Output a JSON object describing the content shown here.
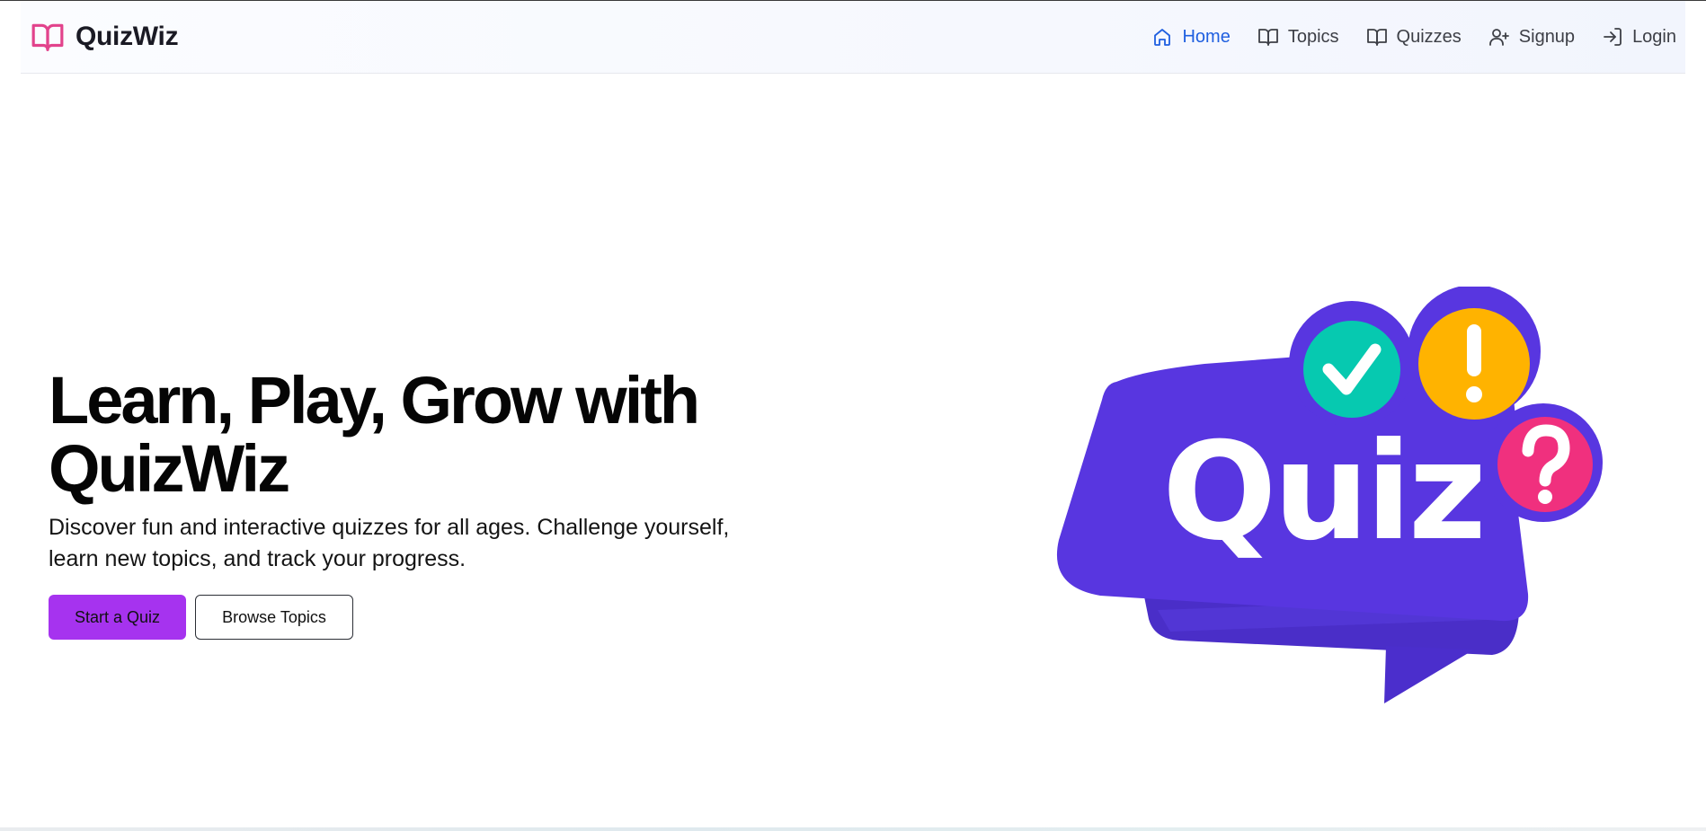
{
  "brand": {
    "name": "QuizWiz",
    "icon": "open-book-icon",
    "icon_color": "#e2438c"
  },
  "nav": {
    "items": [
      {
        "label": "Home",
        "icon": "home-icon",
        "active": true
      },
      {
        "label": "Topics",
        "icon": "open-book-icon",
        "active": false
      },
      {
        "label": "Quizzes",
        "icon": "open-book-icon",
        "active": false
      },
      {
        "label": "Signup",
        "icon": "user-plus-icon",
        "active": false
      },
      {
        "label": "Login",
        "icon": "login-arrow-icon",
        "active": false
      }
    ],
    "active_color": "#1f5fe0"
  },
  "hero": {
    "title": "Learn, Play, Grow with QuizWiz",
    "subtitle": "Discover fun and interactive quizzes for all ages. Challenge yourself, learn new topics, and track your progress.",
    "primary_button": "Start a Quiz",
    "secondary_button": "Browse Topics",
    "primary_color": "#a633ef"
  },
  "illustration": {
    "word": "Quiz",
    "bubble_color": "#5836e0",
    "check_color": "#06c9b0",
    "exclamation_color": "#ffb300",
    "question_color": "#f0307e"
  }
}
